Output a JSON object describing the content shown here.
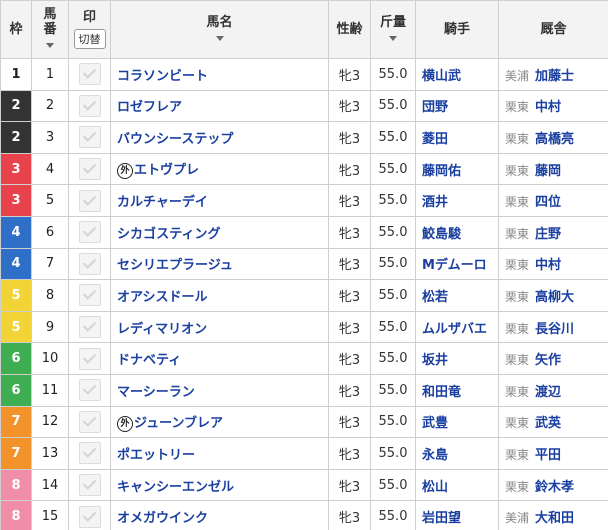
{
  "headers": {
    "waku": "枠",
    "umaban_line1": "馬",
    "umaban_line2": "番",
    "mark": "印",
    "mark_button": "切替",
    "horse": "馬名",
    "sexage": "性齢",
    "weight": "斤量",
    "jockey": "騎手",
    "trainer": "厩舎"
  },
  "rows": [
    {
      "waku": "1",
      "num": "1",
      "prefix": "",
      "horse": "コラソンビート",
      "sexage": "牝3",
      "weight": "55.0",
      "jockey": "横山武",
      "area": "美浦",
      "trainer": "加藤士"
    },
    {
      "waku": "2",
      "num": "2",
      "prefix": "",
      "horse": "ロゼフレア",
      "sexage": "牝3",
      "weight": "55.0",
      "jockey": "団野",
      "area": "栗東",
      "trainer": "中村"
    },
    {
      "waku": "2",
      "num": "3",
      "prefix": "",
      "horse": "バウンシーステップ",
      "sexage": "牝3",
      "weight": "55.0",
      "jockey": "菱田",
      "area": "栗東",
      "trainer": "高橋亮"
    },
    {
      "waku": "3",
      "num": "4",
      "prefix": "外",
      "horse": "エトヴプレ",
      "sexage": "牝3",
      "weight": "55.0",
      "jockey": "藤岡佑",
      "area": "栗東",
      "trainer": "藤岡"
    },
    {
      "waku": "3",
      "num": "5",
      "prefix": "",
      "horse": "カルチャーデイ",
      "sexage": "牝3",
      "weight": "55.0",
      "jockey": "酒井",
      "area": "栗東",
      "trainer": "四位"
    },
    {
      "waku": "4",
      "num": "6",
      "prefix": "",
      "horse": "シカゴスティング",
      "sexage": "牝3",
      "weight": "55.0",
      "jockey": "鮫島駿",
      "area": "栗東",
      "trainer": "庄野"
    },
    {
      "waku": "4",
      "num": "7",
      "prefix": "",
      "horse": "セシリエプラージュ",
      "sexage": "牝3",
      "weight": "55.0",
      "jockey": "Mデムーロ",
      "area": "栗東",
      "trainer": "中村"
    },
    {
      "waku": "5",
      "num": "8",
      "prefix": "",
      "horse": "オアシスドール",
      "sexage": "牝3",
      "weight": "55.0",
      "jockey": "松若",
      "area": "栗東",
      "trainer": "高柳大"
    },
    {
      "waku": "5",
      "num": "9",
      "prefix": "",
      "horse": "レディマリオン",
      "sexage": "牝3",
      "weight": "55.0",
      "jockey": "ムルザバエ",
      "area": "栗東",
      "trainer": "長谷川"
    },
    {
      "waku": "6",
      "num": "10",
      "prefix": "",
      "horse": "ドナベティ",
      "sexage": "牝3",
      "weight": "55.0",
      "jockey": "坂井",
      "area": "栗東",
      "trainer": "矢作"
    },
    {
      "waku": "6",
      "num": "11",
      "prefix": "",
      "horse": "マーシーラン",
      "sexage": "牝3",
      "weight": "55.0",
      "jockey": "和田竜",
      "area": "栗東",
      "trainer": "渡辺"
    },
    {
      "waku": "7",
      "num": "12",
      "prefix": "外",
      "horse": "ジューンブレア",
      "sexage": "牝3",
      "weight": "55.0",
      "jockey": "武豊",
      "area": "栗東",
      "trainer": "武英"
    },
    {
      "waku": "7",
      "num": "13",
      "prefix": "",
      "horse": "ポエットリー",
      "sexage": "牝3",
      "weight": "55.0",
      "jockey": "永島",
      "area": "栗東",
      "trainer": "平田"
    },
    {
      "waku": "8",
      "num": "14",
      "prefix": "",
      "horse": "キャンシーエンゼル",
      "sexage": "牝3",
      "weight": "55.0",
      "jockey": "松山",
      "area": "栗東",
      "trainer": "鈴木孝"
    },
    {
      "waku": "8",
      "num": "15",
      "prefix": "",
      "horse": "オメガウインク",
      "sexage": "牝3",
      "weight": "55.0",
      "jockey": "岩田望",
      "area": "美浦",
      "trainer": "大和田"
    }
  ]
}
